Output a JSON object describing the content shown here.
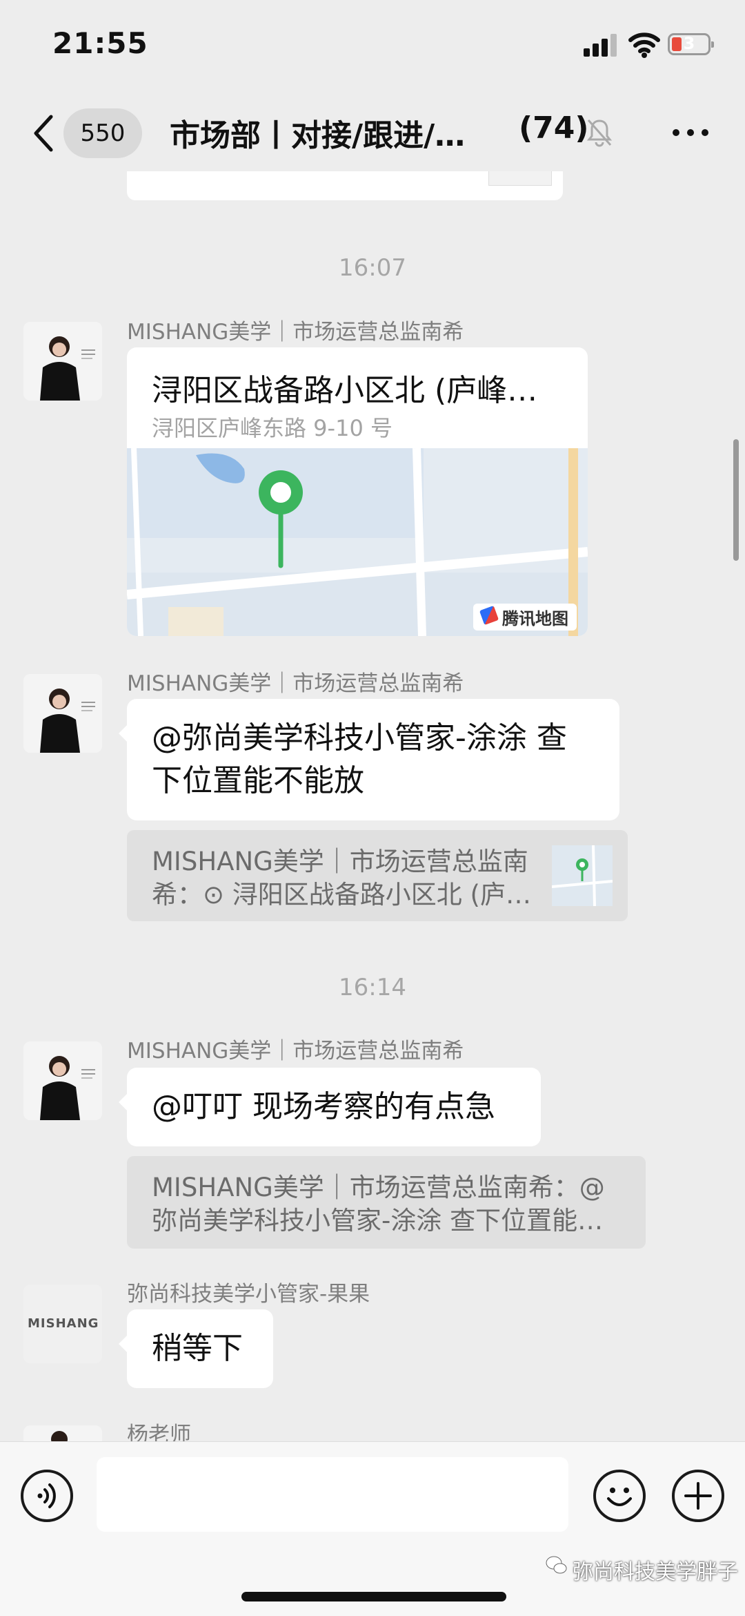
{
  "status": {
    "time": "21:55",
    "battery": "3"
  },
  "nav": {
    "unread": "550",
    "title": "市场部丨对接/跟进/…",
    "count": "(74)"
  },
  "messages": {
    "ts1": "16:07",
    "ts2": "16:14",
    "m1": {
      "sender": "MISHANG美学｜市场运营总监南希",
      "loc_title": "浔阳区战备路小区北 (庐峰…",
      "loc_addr": "浔阳区庐峰东路 9-10 号",
      "map_brand": "腾讯地图"
    },
    "m2": {
      "sender": "MISHANG美学｜市场运营总监南希",
      "line1": "@弥尚美学科技小管家-涂涂 查",
      "line2": "下位置能不能放",
      "quote_line1": "MISHANG美学｜市场运营总监南",
      "quote_line2": "希：⊙ 浔阳区战备路小区北 (庐…"
    },
    "m3": {
      "sender": "MISHANG美学｜市场运营总监南希",
      "text": "@叮叮 现场考察的有点急",
      "quote_line1": "MISHANG美学｜市场运营总监南希：@",
      "quote_line2": "弥尚美学科技小管家-涂涂 查下位置能…"
    },
    "m4": {
      "sender": "弥尚科技美学小管家-果果",
      "text": "稍等下",
      "avatar_text": "MISHANG"
    },
    "m5": {
      "sender": "杨老师"
    }
  },
  "input": {
    "value": "",
    "placeholder": ""
  },
  "watermark": "弥尚科技美学胖子",
  "colors": {
    "bg": "#ededed",
    "bubble": "#ffffff",
    "quote": "#e0e0e0",
    "pin": "#3cb55e"
  },
  "icons": [
    "back-icon",
    "mute-icon",
    "more-icon",
    "voice-icon",
    "emoji-icon",
    "plus-icon",
    "location-pin-icon"
  ]
}
